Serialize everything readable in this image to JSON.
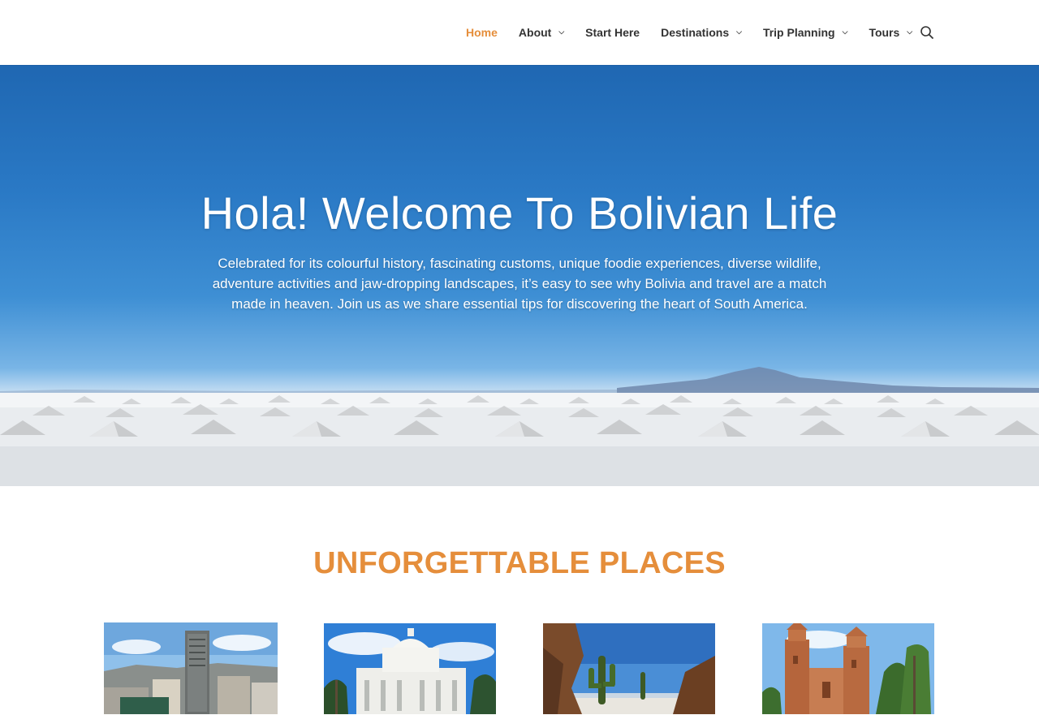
{
  "nav": {
    "items": [
      {
        "label": "Home",
        "active": true,
        "has_dropdown": false
      },
      {
        "label": "About",
        "active": false,
        "has_dropdown": true
      },
      {
        "label": "Start Here",
        "active": false,
        "has_dropdown": false
      },
      {
        "label": "Destinations",
        "active": false,
        "has_dropdown": true
      },
      {
        "label": "Trip Planning",
        "active": false,
        "has_dropdown": true
      },
      {
        "label": "Tours",
        "active": false,
        "has_dropdown": true
      }
    ],
    "dropdown_icon": "chevron-down-icon",
    "search_icon": "search-icon"
  },
  "hero": {
    "title": "Hola! Welcome To Bolivian Life",
    "subtitle": "Celebrated for its colourful history, fascinating customs, unique foodie experiences, diverse wildlife, adventure activities and jaw-dropping landscapes, it’s easy to see why Bolivia and travel are a match made in heaven. Join us as we share essential tips for discovering the heart of South America."
  },
  "places": {
    "title": "UNFORGETTABLE PLACES",
    "cards": [
      {
        "image": "city-skyline-photo"
      },
      {
        "image": "white-colonial-building-photo"
      },
      {
        "image": "cactus-salt-flat-photo"
      },
      {
        "image": "brick-cathedral-photo"
      }
    ]
  },
  "colors": {
    "accent": "#e58e3b",
    "nav_text": "#333333",
    "hero_text": "#ffffff"
  }
}
